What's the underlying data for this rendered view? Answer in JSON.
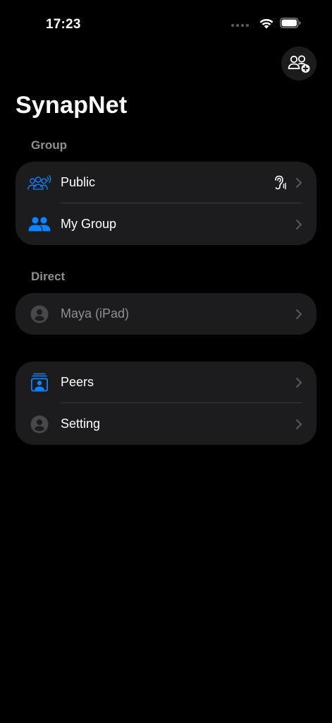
{
  "status_bar": {
    "time": "17:23"
  },
  "header": {
    "title": "SynapNet",
    "add_group_icon": "person-2-plus-icon"
  },
  "sections": {
    "group": {
      "header": "Group",
      "items": [
        {
          "label": "Public",
          "icon": "person-3-wave-icon",
          "trailing_icon": "ear-icon"
        },
        {
          "label": "My Group",
          "icon": "person-2-fill-icon"
        }
      ]
    },
    "direct": {
      "header": "Direct",
      "items": [
        {
          "label": "Maya (iPad)",
          "icon": "person-circle-icon"
        }
      ]
    },
    "other": {
      "items": [
        {
          "label": "Peers",
          "icon": "person-crop-rectangle-stack-icon"
        },
        {
          "label": "Setting",
          "icon": "person-circle-icon"
        }
      ]
    }
  },
  "colors": {
    "background": "#000000",
    "card": "#1c1c1e",
    "accent": "#0a84ff",
    "secondary_text": "#8e8e93",
    "divider": "#3a3a3c"
  }
}
